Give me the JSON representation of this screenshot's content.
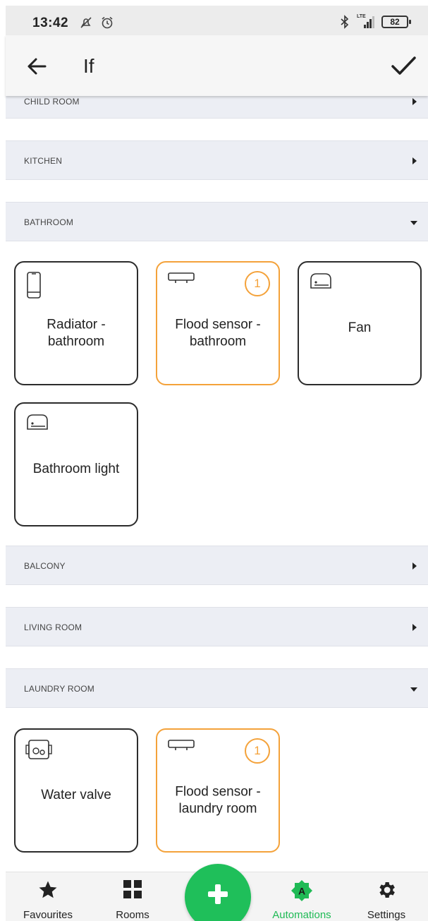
{
  "status": {
    "time": "13:42",
    "battery": "82",
    "network": "LTE"
  },
  "header": {
    "title": "If"
  },
  "sections": [
    {
      "label": "CHILD ROOM",
      "expanded": false
    },
    {
      "label": "KITCHEN",
      "expanded": false
    },
    {
      "label": "BATHROOM",
      "expanded": true
    },
    {
      "label": "BALCONY",
      "expanded": false
    },
    {
      "label": "LIVING ROOM",
      "expanded": false
    },
    {
      "label": "LAUNDRY ROOM",
      "expanded": true
    }
  ],
  "bathroom_devices": [
    {
      "label": "Radiator - bathroom",
      "icon": "radiator-icon",
      "selected": false
    },
    {
      "label": "Flood sensor - bathroom",
      "icon": "flood-sensor-icon",
      "selected": true,
      "badge": "1"
    },
    {
      "label": "Fan",
      "icon": "switch-icon",
      "selected": false
    },
    {
      "label": "Bathroom light",
      "icon": "switch-icon",
      "selected": false
    }
  ],
  "laundry_devices": [
    {
      "label": "Water valve",
      "icon": "valve-icon",
      "selected": false
    },
    {
      "label": "Flood sensor - laundry room",
      "icon": "flood-sensor-icon",
      "selected": true,
      "badge": "1"
    }
  ],
  "bottom_nav": [
    {
      "label": "Favourites",
      "icon": "star-icon",
      "active": false
    },
    {
      "label": "Rooms",
      "icon": "grid-icon",
      "active": false
    },
    {
      "label": "Automations",
      "icon": "automations-icon",
      "active": true
    },
    {
      "label": "Settings",
      "icon": "gear-icon",
      "active": false
    }
  ],
  "fab": {
    "icon": "plus-icon"
  },
  "colors": {
    "accent": "#1fbf5a",
    "selected_border": "#f4a23a",
    "section_bg": "#eceef4"
  }
}
